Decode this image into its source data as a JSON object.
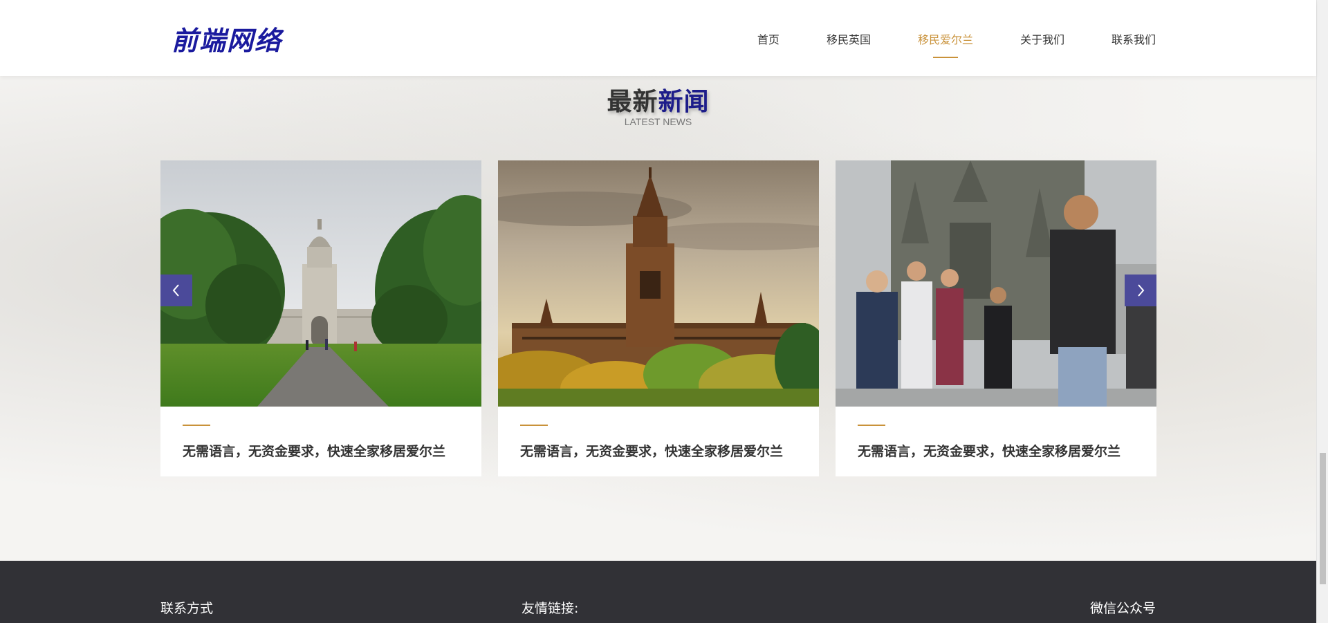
{
  "header": {
    "logo": "前端网络",
    "nav": [
      {
        "label": "首页",
        "active": false
      },
      {
        "label": "移民英国",
        "active": false
      },
      {
        "label": "移民爱尔兰",
        "active": true
      },
      {
        "label": "关于我们",
        "active": false
      },
      {
        "label": "联系我们",
        "active": false
      }
    ]
  },
  "news": {
    "title_part1": "最新",
    "title_part2": "新闻",
    "subtitle": "LATEST NEWS",
    "prev_icon": "chevron-left-icon",
    "next_icon": "chevron-right-icon",
    "cards": [
      {
        "title": "无需语言，无资金要求，快速全家移居爱尔兰",
        "image": "college-campus-photo"
      },
      {
        "title": "无需语言，无资金要求，快速全家移居爱尔兰",
        "image": "gothic-university-tower-photo"
      },
      {
        "title": "无需语言，无资金要求，快速全家移居爱尔兰",
        "image": "street-crowd-photo"
      }
    ]
  },
  "footer": {
    "contact": "联系方式",
    "links": "友情链接:",
    "wechat": "微信公众号"
  },
  "colors": {
    "brand": "#1a1a9e",
    "accent": "#c9923a",
    "arrow_bg": "#4b4a9a",
    "footer_bg": "#313136"
  }
}
